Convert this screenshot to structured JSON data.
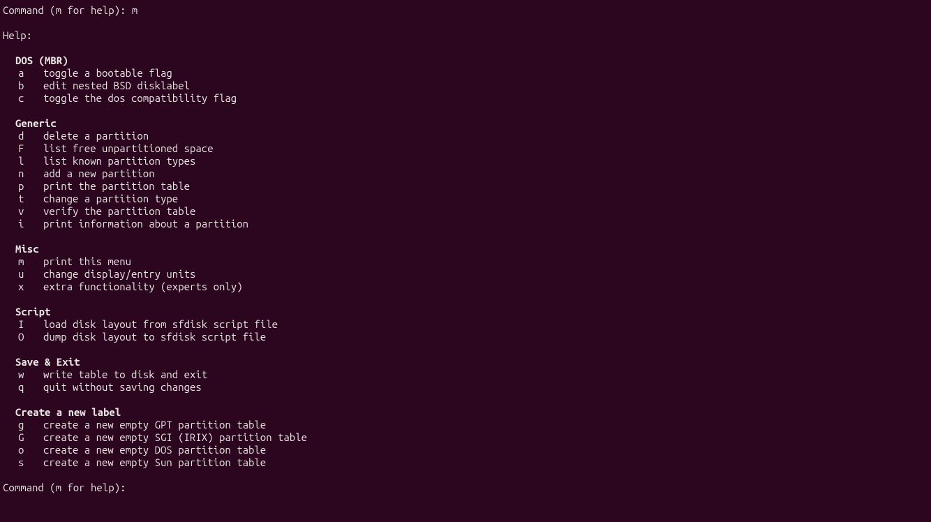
{
  "prompt1": "Command (m for help): m",
  "helpLabel": "Help:",
  "sections": [
    {
      "title": "DOS (MBR)",
      "items": [
        {
          "key": "a",
          "desc": "toggle a bootable flag"
        },
        {
          "key": "b",
          "desc": "edit nested BSD disklabel"
        },
        {
          "key": "c",
          "desc": "toggle the dos compatibility flag"
        }
      ]
    },
    {
      "title": "Generic",
      "items": [
        {
          "key": "d",
          "desc": "delete a partition"
        },
        {
          "key": "F",
          "desc": "list free unpartitioned space"
        },
        {
          "key": "l",
          "desc": "list known partition types"
        },
        {
          "key": "n",
          "desc": "add a new partition"
        },
        {
          "key": "p",
          "desc": "print the partition table"
        },
        {
          "key": "t",
          "desc": "change a partition type"
        },
        {
          "key": "v",
          "desc": "verify the partition table"
        },
        {
          "key": "i",
          "desc": "print information about a partition"
        }
      ]
    },
    {
      "title": "Misc",
      "items": [
        {
          "key": "m",
          "desc": "print this menu"
        },
        {
          "key": "u",
          "desc": "change display/entry units"
        },
        {
          "key": "x",
          "desc": "extra functionality (experts only)"
        }
      ]
    },
    {
      "title": "Script",
      "items": [
        {
          "key": "I",
          "desc": "load disk layout from sfdisk script file"
        },
        {
          "key": "O",
          "desc": "dump disk layout to sfdisk script file"
        }
      ]
    },
    {
      "title": "Save & Exit",
      "items": [
        {
          "key": "w",
          "desc": "write table to disk and exit"
        },
        {
          "key": "q",
          "desc": "quit without saving changes"
        }
      ]
    },
    {
      "title": "Create a new label",
      "items": [
        {
          "key": "g",
          "desc": "create a new empty GPT partition table"
        },
        {
          "key": "G",
          "desc": "create a new empty SGI (IRIX) partition table"
        },
        {
          "key": "o",
          "desc": "create a new empty DOS partition table"
        },
        {
          "key": "s",
          "desc": "create a new empty Sun partition table"
        }
      ]
    }
  ],
  "prompt2": "Command (m for help): "
}
